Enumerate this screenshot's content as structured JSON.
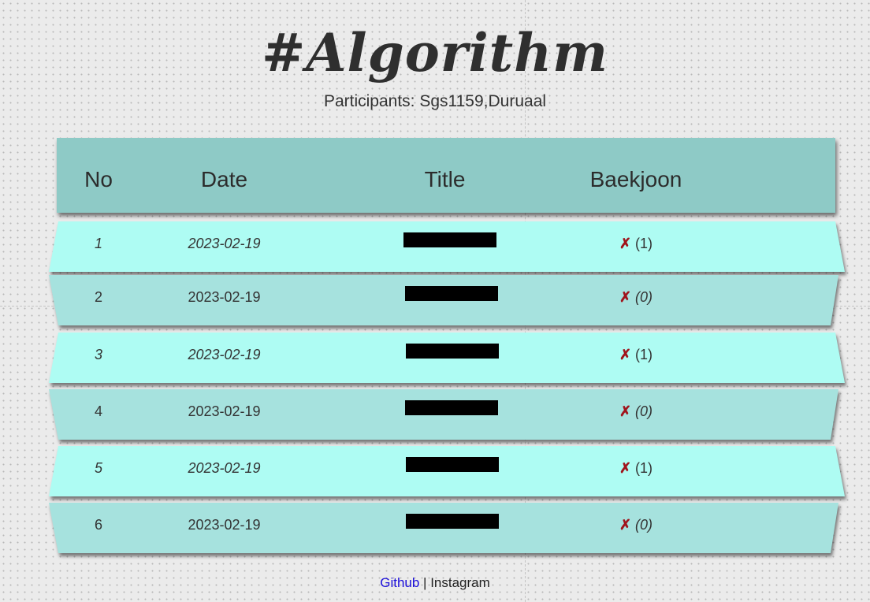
{
  "page": {
    "title": "#Algorithm",
    "participants": "Participants: Sgs1159,Duruaal"
  },
  "table": {
    "headers": {
      "no": "No",
      "date": "Date",
      "title": "Title",
      "baekjoon": "Baekjoon"
    },
    "rows": [
      {
        "no": "1",
        "date": "2023-02-19",
        "mark": "✗",
        "count": "(1)"
      },
      {
        "no": "2",
        "date": "2023-02-19",
        "mark": "✗",
        "count": "(0)"
      },
      {
        "no": "3",
        "date": "2023-02-19",
        "mark": "✗",
        "count": "(1)"
      },
      {
        "no": "4",
        "date": "2023-02-19",
        "mark": "✗",
        "count": "(0)"
      },
      {
        "no": "5",
        "date": "2023-02-19",
        "mark": "✗",
        "count": "(1)"
      },
      {
        "no": "6",
        "date": "2023-02-19",
        "mark": "✗",
        "count": "(0)"
      }
    ]
  },
  "footer": {
    "github": "Github",
    "separator": " | ",
    "instagram": "Instagram"
  },
  "colors": {
    "header_bg": "#8ecac6",
    "row_odd_bg": "#aefcf3",
    "row_even_bg": "#a6e2de",
    "cross": "#a0141c",
    "link": "#1a0dd9"
  }
}
